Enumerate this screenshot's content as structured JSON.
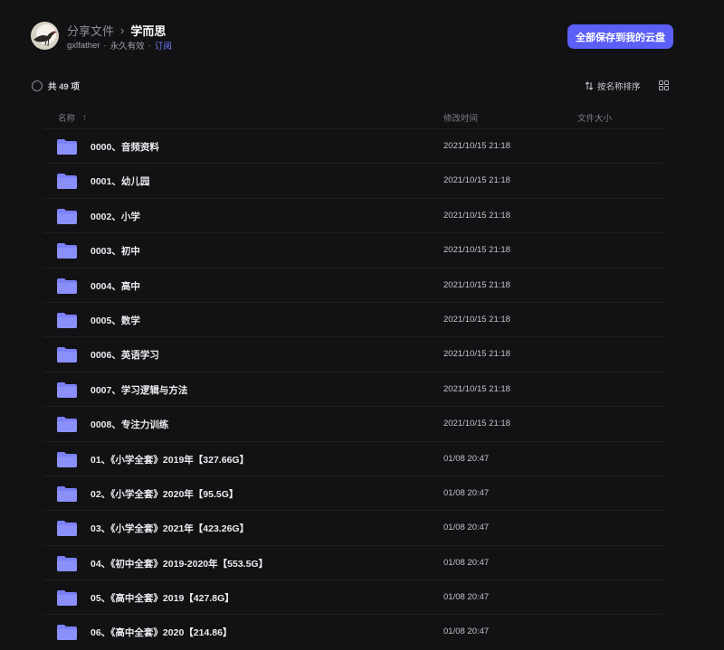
{
  "header": {
    "breadcrumb_root": "分享文件",
    "breadcrumb_sep": "›",
    "breadcrumb_current": "学而思",
    "owner": "gxlfather",
    "validity": "永久有效",
    "subscribe": "订阅",
    "dot": "·",
    "save_button": "全部保存到我的云盘"
  },
  "toolbar": {
    "count": "共 49 项",
    "sort_label": "按名称排序"
  },
  "columns": {
    "name": "名称",
    "name_sort_arrow": "↑",
    "modified": "修改时间",
    "size": "文件大小"
  },
  "colors": {
    "accent": "#5b5ff5",
    "folder": "#7b80f7",
    "background": "#121214"
  },
  "files": [
    {
      "name": "0000、音频资料",
      "time": "2021/10/15 21:18",
      "size": ""
    },
    {
      "name": "0001、幼儿园",
      "time": "2021/10/15 21:18",
      "size": ""
    },
    {
      "name": "0002、小学",
      "time": "2021/10/15 21:18",
      "size": ""
    },
    {
      "name": "0003、初中",
      "time": "2021/10/15 21:18",
      "size": ""
    },
    {
      "name": "0004、高中",
      "time": "2021/10/15 21:18",
      "size": ""
    },
    {
      "name": "0005、数学",
      "time": "2021/10/15 21:18",
      "size": ""
    },
    {
      "name": "0006、英语学习",
      "time": "2021/10/15 21:18",
      "size": ""
    },
    {
      "name": "0007、学习逻辑与方法",
      "time": "2021/10/15 21:18",
      "size": ""
    },
    {
      "name": "0008、专注力训练",
      "time": "2021/10/15 21:18",
      "size": ""
    },
    {
      "name": "01、《小学全套》2019年【327.66G】",
      "time": "01/08 20:47",
      "size": ""
    },
    {
      "name": "02、《小学全套》2020年【95.5G】",
      "time": "01/08 20:47",
      "size": ""
    },
    {
      "name": "03、《小学全套》2021年【423.26G】",
      "time": "01/08 20:47",
      "size": ""
    },
    {
      "name": "04、《初中全套》2019-2020年【553.5G】",
      "time": "01/08 20:47",
      "size": ""
    },
    {
      "name": "05、《高中全套》2019【427.8G】",
      "time": "01/08 20:47",
      "size": ""
    },
    {
      "name": "06、《高中全套》2020【214.86】",
      "time": "01/08 20:47",
      "size": ""
    }
  ]
}
